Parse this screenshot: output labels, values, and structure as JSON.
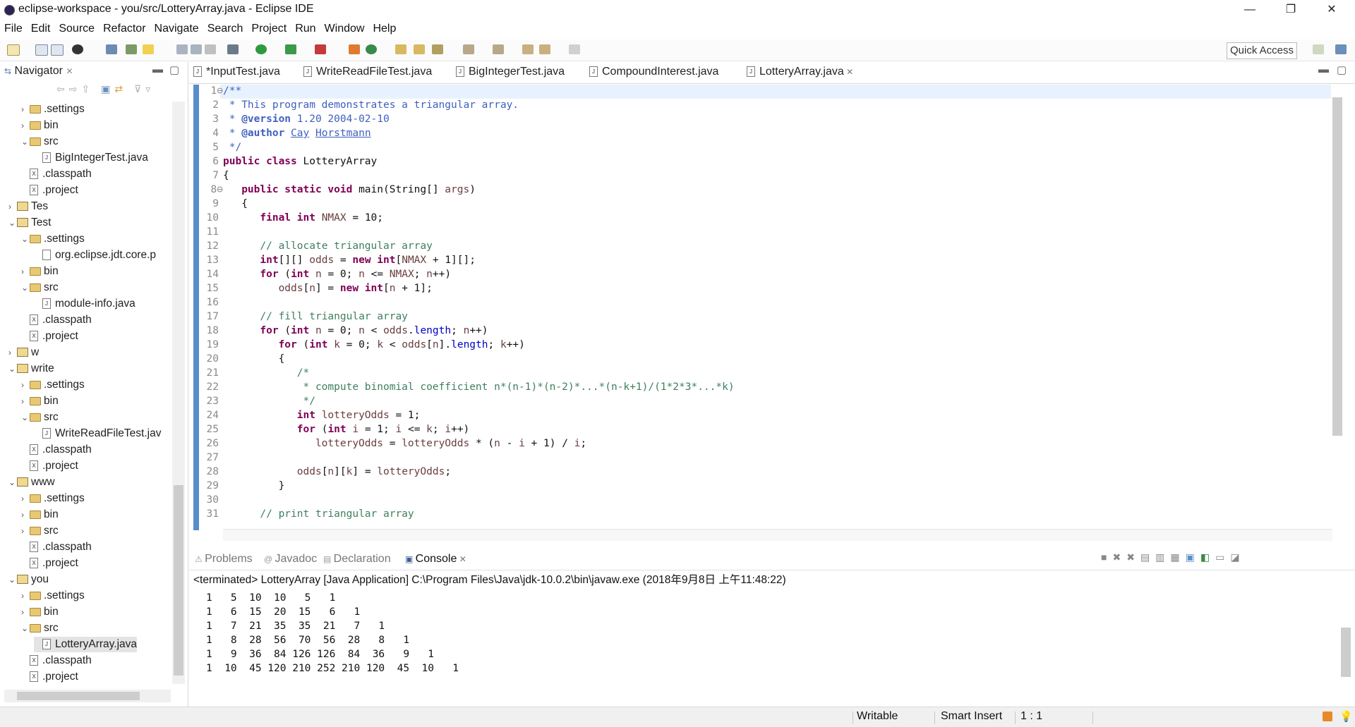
{
  "window": {
    "title": "eclipse-workspace - you/src/LotteryArray.java - Eclipse IDE",
    "controls": [
      "—",
      "❐",
      "✕"
    ]
  },
  "menu": [
    "File",
    "Edit",
    "Source",
    "Refactor",
    "Navigate",
    "Search",
    "Project",
    "Run",
    "Window",
    "Help"
  ],
  "quick_access": "Quick Access",
  "navigator": {
    "title": "Navigator",
    "items": [
      {
        "label": ".settings",
        "kind": "folder",
        "indent": 1,
        "twisty": "›"
      },
      {
        "label": "bin",
        "kind": "folder",
        "indent": 1,
        "twisty": "›"
      },
      {
        "label": "src",
        "kind": "folder",
        "indent": 1,
        "twisty": "⌄"
      },
      {
        "label": "BigIntegerTest.java",
        "kind": "java",
        "indent": 2,
        "twisty": ""
      },
      {
        "label": ".classpath",
        "kind": "xml",
        "indent": 1,
        "twisty": ""
      },
      {
        "label": ".project",
        "kind": "xml",
        "indent": 1,
        "twisty": ""
      },
      {
        "label": "Tes",
        "kind": "project",
        "indent": 0,
        "twisty": "›"
      },
      {
        "label": "Test",
        "kind": "project",
        "indent": 0,
        "twisty": "⌄"
      },
      {
        "label": ".settings",
        "kind": "folder",
        "indent": 1,
        "twisty": "⌄"
      },
      {
        "label": "org.eclipse.jdt.core.p",
        "kind": "file",
        "indent": 2,
        "twisty": ""
      },
      {
        "label": "bin",
        "kind": "folder",
        "indent": 1,
        "twisty": "›"
      },
      {
        "label": "src",
        "kind": "folder",
        "indent": 1,
        "twisty": "⌄"
      },
      {
        "label": "module-info.java",
        "kind": "java",
        "indent": 2,
        "twisty": ""
      },
      {
        "label": ".classpath",
        "kind": "xml",
        "indent": 1,
        "twisty": ""
      },
      {
        "label": ".project",
        "kind": "xml",
        "indent": 1,
        "twisty": ""
      },
      {
        "label": "w",
        "kind": "project",
        "indent": 0,
        "twisty": "›"
      },
      {
        "label": "write",
        "kind": "project",
        "indent": 0,
        "twisty": "⌄"
      },
      {
        "label": ".settings",
        "kind": "folder",
        "indent": 1,
        "twisty": "›"
      },
      {
        "label": "bin",
        "kind": "folder",
        "indent": 1,
        "twisty": "›"
      },
      {
        "label": "src",
        "kind": "folder",
        "indent": 1,
        "twisty": "⌄"
      },
      {
        "label": "WriteReadFileTest.jav",
        "kind": "java",
        "indent": 2,
        "twisty": ""
      },
      {
        "label": ".classpath",
        "kind": "xml",
        "indent": 1,
        "twisty": ""
      },
      {
        "label": ".project",
        "kind": "xml",
        "indent": 1,
        "twisty": ""
      },
      {
        "label": "www",
        "kind": "project",
        "indent": 0,
        "twisty": "⌄"
      },
      {
        "label": ".settings",
        "kind": "folder",
        "indent": 1,
        "twisty": "›"
      },
      {
        "label": "bin",
        "kind": "folder",
        "indent": 1,
        "twisty": "›"
      },
      {
        "label": "src",
        "kind": "folder",
        "indent": 1,
        "twisty": "›"
      },
      {
        "label": ".classpath",
        "kind": "xml",
        "indent": 1,
        "twisty": ""
      },
      {
        "label": ".project",
        "kind": "xml",
        "indent": 1,
        "twisty": ""
      },
      {
        "label": "you",
        "kind": "project",
        "indent": 0,
        "twisty": "⌄"
      },
      {
        "label": ".settings",
        "kind": "folder",
        "indent": 1,
        "twisty": "›"
      },
      {
        "label": "bin",
        "kind": "folder",
        "indent": 1,
        "twisty": "›"
      },
      {
        "label": "src",
        "kind": "folder",
        "indent": 1,
        "twisty": "⌄"
      },
      {
        "label": "LotteryArray.java",
        "kind": "java",
        "indent": 2,
        "twisty": "",
        "selected": true
      },
      {
        "label": ".classpath",
        "kind": "xml",
        "indent": 1,
        "twisty": ""
      },
      {
        "label": ".project",
        "kind": "xml",
        "indent": 1,
        "twisty": ""
      }
    ]
  },
  "editor_tabs": [
    {
      "label": "*InputTest.java",
      "active": false
    },
    {
      "label": "WriteReadFileTest.java",
      "active": false
    },
    {
      "label": "BigIntegerTest.java",
      "active": false
    },
    {
      "label": "CompoundInterest.java",
      "active": false
    },
    {
      "label": "LotteryArray.java",
      "active": true
    }
  ],
  "code_lines": [
    {
      "n": "1",
      "fold": "⊖",
      "html": "<span class='jd'>/**</span>"
    },
    {
      "n": "2",
      "html": "<span class='jd'> * This program demonstrates a triangular array.</span>"
    },
    {
      "n": "3",
      "html": "<span class='jd'> * <b>@version</b> 1.20 2004-02-10</span>"
    },
    {
      "n": "4",
      "html": "<span class='jd'> * <b>@author</b> <u>Cay</u> <u>Horstmann</u></span>"
    },
    {
      "n": "5",
      "html": "<span class='jd'> */</span>"
    },
    {
      "n": "6",
      "html": "<span class='kw'>public class</span> LotteryArray"
    },
    {
      "n": "7",
      "html": "{"
    },
    {
      "n": "8",
      "fold": "⊖",
      "html": "   <span class='kw'>public static void</span> main(String[] <span class='var'>args</span>)"
    },
    {
      "n": "9",
      "html": "   {"
    },
    {
      "n": "10",
      "html": "      <span class='kw'>final int</span> <span class='var'>NMAX</span> = 10;"
    },
    {
      "n": "11",
      "html": ""
    },
    {
      "n": "12",
      "html": "      <span class='cm'>// allocate triangular array</span>"
    },
    {
      "n": "13",
      "html": "      <span class='kw'>int</span>[][] <span class='var'>odds</span> = <span class='kw'>new int</span>[<span class='var'>NMAX</span> + 1][];"
    },
    {
      "n": "14",
      "html": "      <span class='kw'>for</span> (<span class='kw'>int</span> <span class='var'>n</span> = 0; <span class='var'>n</span> &lt;= <span class='var'>NMAX</span>; <span class='var'>n</span>++)"
    },
    {
      "n": "15",
      "html": "         <span class='var'>odds</span>[<span class='var'>n</span>] = <span class='kw'>new int</span>[<span class='var'>n</span> + 1];"
    },
    {
      "n": "16",
      "html": ""
    },
    {
      "n": "17",
      "html": "      <span class='cm'>// fill triangular array</span>"
    },
    {
      "n": "18",
      "html": "      <span class='kw'>for</span> (<span class='kw'>int</span> <span class='var'>n</span> = 0; <span class='var'>n</span> &lt; <span class='var'>odds</span>.<span class='fld'>length</span>; <span class='var'>n</span>++)"
    },
    {
      "n": "19",
      "html": "         <span class='kw'>for</span> (<span class='kw'>int</span> <span class='var'>k</span> = 0; <span class='var'>k</span> &lt; <span class='var'>odds</span>[<span class='var'>n</span>].<span class='fld'>length</span>; <span class='var'>k</span>++)"
    },
    {
      "n": "20",
      "html": "         {"
    },
    {
      "n": "21",
      "html": "            <span class='cm'>/*</span>"
    },
    {
      "n": "22",
      "html": "<span class='cm'>             * compute binomial coefficient n*(n-1)*(n-2)*...*(n-k+1)/(1*2*3*...*k)</span>"
    },
    {
      "n": "23",
      "html": "<span class='cm'>             */</span>"
    },
    {
      "n": "24",
      "html": "            <span class='kw'>int</span> <span class='var'>lotteryOdds</span> = 1;"
    },
    {
      "n": "25",
      "html": "            <span class='kw'>for</span> (<span class='kw'>int</span> <span class='var'>i</span> = 1; <span class='var'>i</span> &lt;= <span class='var'>k</span>; <span class='var'>i</span>++)"
    },
    {
      "n": "26",
      "html": "               <span class='var'>lotteryOdds</span> = <span class='var'>lotteryOdds</span> * (<span class='var'>n</span> - <span class='var'>i</span> + 1) / <span class='var'>i</span>;"
    },
    {
      "n": "27",
      "html": ""
    },
    {
      "n": "28",
      "html": "            <span class='var'>odds</span>[<span class='var'>n</span>][<span class='var'>k</span>] = <span class='var'>lotteryOdds</span>;"
    },
    {
      "n": "29",
      "html": "         }"
    },
    {
      "n": "30",
      "html": ""
    },
    {
      "n": "31",
      "html": "      <span class='cm'>// print triangular array</span>"
    }
  ],
  "bottom_tabs": [
    {
      "label": "Problems",
      "active": false
    },
    {
      "label": "Javadoc",
      "active": false
    },
    {
      "label": "Declaration",
      "active": false
    },
    {
      "label": "Console",
      "active": true
    }
  ],
  "console": {
    "header": "<terminated> LotteryArray [Java Application] C:\\Program Files\\Java\\jdk-10.0.2\\bin\\javaw.exe (2018年9月8日 上午11:48:22)",
    "lines": [
      "1   5  10  10   5   1",
      "1   6  15  20  15   6   1",
      "1   7  21  35  35  21   7   1",
      "1   8  28  56  70  56  28   8   1",
      "1   9  36  84 126 126  84  36   9   1",
      "1  10  45 120 210 252 210 120  45  10   1"
    ]
  },
  "status": {
    "writable": "Writable",
    "insert_mode": "Smart Insert",
    "position": "1 : 1"
  }
}
